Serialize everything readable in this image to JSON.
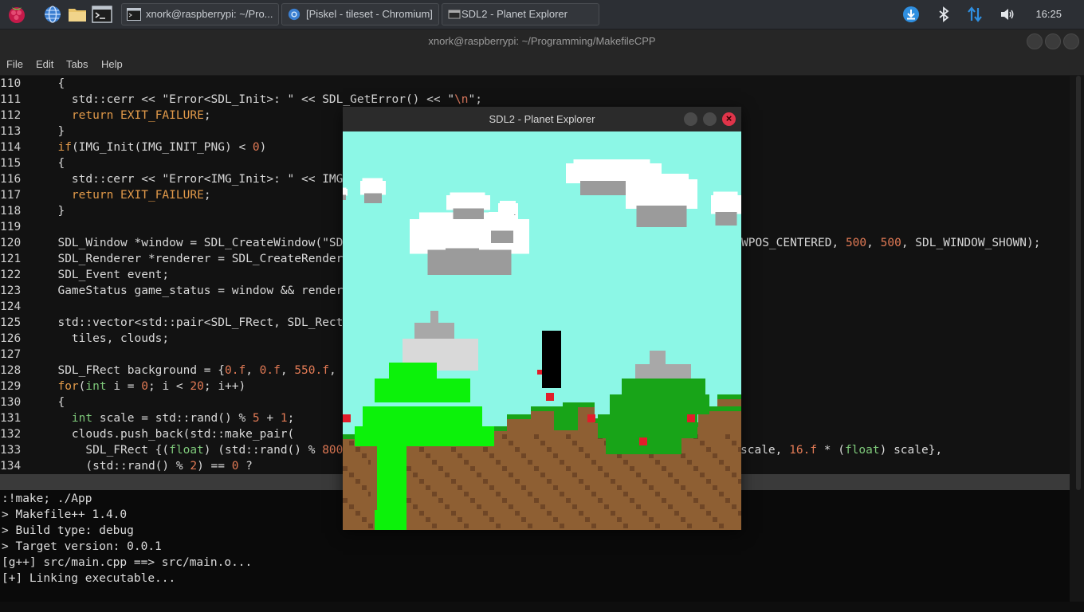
{
  "taskbar": {
    "tasks": [
      {
        "label": "xnork@raspberrypi: ~/Pro..."
      },
      {
        "label": "[Piskel - tileset - Chromium]"
      },
      {
        "label": "SDL2 - Planet Explorer"
      }
    ],
    "clock": "16:25",
    "icons": [
      "raspberry-menu-icon",
      "globe-browser-icon",
      "file-manager-icon",
      "terminal-icon",
      "download-icon",
      "bluetooth-icon",
      "network-icon",
      "volume-icon"
    ]
  },
  "terminal": {
    "title": "xnork@raspberrypi: ~/Programming/MakefileCPP",
    "menu": [
      "File",
      "Edit",
      "Tabs",
      "Help"
    ],
    "code": [
      {
        "n": "110",
        "t": "  {"
      },
      {
        "n": "111",
        "t": "    std::cerr << \"Error<SDL_Init>: \" << SDL_GetError() << \"\\n\";"
      },
      {
        "n": "112",
        "t": "    return EXIT_FAILURE;"
      },
      {
        "n": "113",
        "t": "  }"
      },
      {
        "n": "114",
        "t": "  if(IMG_Init(IMG_INIT_PNG) < 0)"
      },
      {
        "n": "115",
        "t": "  {"
      },
      {
        "n": "116",
        "t": "    std::cerr << \"Error<IMG_Init>: \" << IMG_"
      },
      {
        "n": "117",
        "t": "    return EXIT_FAILURE;"
      },
      {
        "n": "118",
        "t": "  }"
      },
      {
        "n": "119",
        "t": ""
      },
      {
        "n": "120",
        "t": "  SDL_Window *window = SDL_CreateWindow(\"SDL"
      },
      {
        "n": "121",
        "t": "  SDL_Renderer *renderer = SDL_CreateRendere"
      },
      {
        "n": "122",
        "t": "  SDL_Event event;"
      },
      {
        "n": "123",
        "t": "  GameStatus game_status = window && rendere"
      },
      {
        "n": "124",
        "t": ""
      },
      {
        "n": "125",
        "t": "  std::vector<std::pair<SDL_FRect, SDL_Rect>"
      },
      {
        "n": "126",
        "t": "    tiles, clouds;"
      },
      {
        "n": "127",
        "t": ""
      },
      {
        "n": "128",
        "t": "  SDL_FRect background = {0.f, 0.f, 550.f, 5"
      },
      {
        "n": "129",
        "t": "  for(int i = 0; i < 20; i++)"
      },
      {
        "n": "130",
        "t": "  {"
      },
      {
        "n": "131",
        "t": "    int scale = std::rand() % 5 + 1;"
      },
      {
        "n": "132",
        "t": "    clouds.push_back(std::make_pair("
      },
      {
        "n": "133",
        "t": "      SDL_FRect {(float) (std::rand() % 800"
      },
      {
        "n": "134",
        "t": "      (std::rand() % 2) == 0 ?"
      }
    ],
    "code_right": [
      {
        "line": "120",
        "t": "WPOS_CENTERED, 500, 500, SDL_WINDOW_SHOWN);"
      },
      {
        "line": "133",
        "t": "scale, 16.f * (float) scale},"
      }
    ],
    "output": [
      ":!make; ./App",
      "> Makefile++ 1.4.0",
      "> Build type: debug",
      "> Target version: 0.0.1",
      "[g++] src/main.cpp ==> src/main.o...",
      "[+] Linking executable..."
    ]
  },
  "game": {
    "title": "SDL2 - Planet Explorer",
    "close_glyph": "×",
    "colors": {
      "sky": "#8cf7e6",
      "cloud": "#ffffff",
      "cloud_shadow": "#9b9b9b",
      "grass_bright": "#0cf20a",
      "grass_dark": "#18a418",
      "dirt": "#8e5f33",
      "dirt_dark": "#6f4626",
      "rock": "#a8a8a8",
      "snow": "#d9d9d9",
      "flower": "#e11d2a",
      "player": "#000000"
    }
  }
}
